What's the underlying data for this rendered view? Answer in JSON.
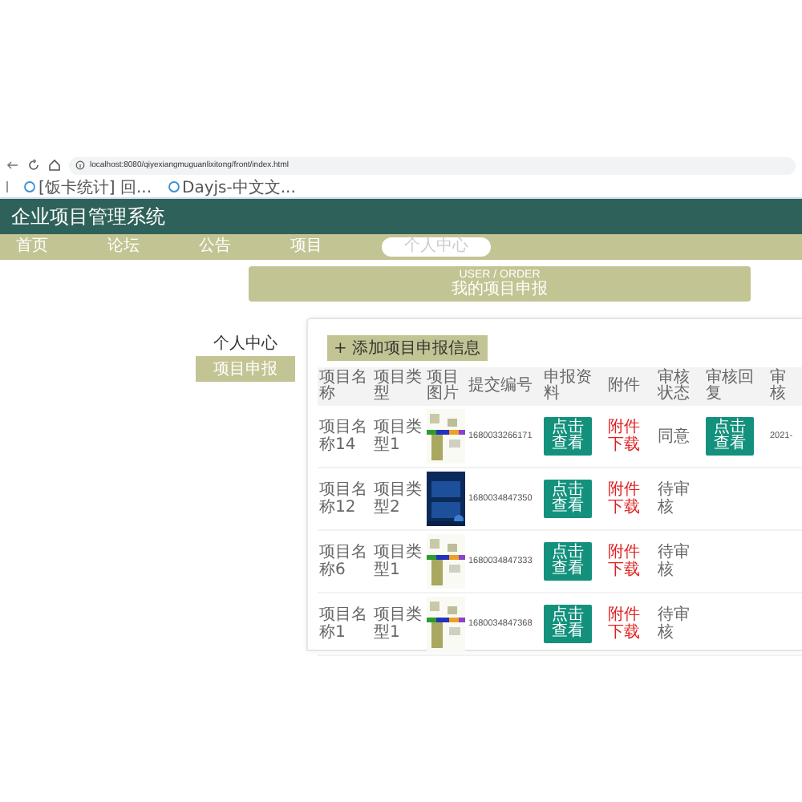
{
  "browser": {
    "url": "localhost:8080/qiyexiangmuguanlixitong/front/index.html",
    "bookmarks": [
      "[饭卡统计] 回...",
      "Dayjs-中文文..."
    ]
  },
  "header": {
    "title": "企业项目管理系统"
  },
  "nav": [
    {
      "label": "首页",
      "selected": false
    },
    {
      "label": "论坛",
      "selected": false
    },
    {
      "label": "公告",
      "selected": false
    },
    {
      "label": "项目",
      "selected": false
    },
    {
      "label": "个人中心",
      "selected": true
    }
  ],
  "banner": {
    "subtitle": "USER / ORDER",
    "title": "我的项目申报"
  },
  "sidebar": [
    {
      "label": "个人中心",
      "selected": false
    },
    {
      "label": "项目申报",
      "selected": true
    }
  ],
  "add_button": {
    "icon": "+",
    "label": "添加项目申报信息"
  },
  "table": {
    "columns": [
      "项目名称",
      "项目类型",
      "项目图片",
      "提交编号",
      "申报资料",
      "附件",
      "审核状态",
      "审核回复",
      "审核"
    ],
    "rows": [
      {
        "name": "项目名称14",
        "type": "项目类型1",
        "number": "1680033266171",
        "apply": "点击查看",
        "attachment": "附件下载",
        "status": "同意",
        "reply": "点击查看",
        "time": "2021-"
      },
      {
        "name": "项目名称12",
        "type": "项目类型2",
        "number": "1680034847350",
        "apply": "点击查看",
        "attachment": "附件下载",
        "status": "待审核"
      },
      {
        "name": "项目名称6",
        "type": "项目类型1",
        "number": "1680034847333",
        "apply": "点击查看",
        "attachment": "附件下载",
        "status": "待审核"
      },
      {
        "name": "项目名称1",
        "type": "项目类型1",
        "number": "1680034847368",
        "apply": "点击查看",
        "attachment": "附件下载",
        "status": "待审核"
      }
    ]
  }
}
